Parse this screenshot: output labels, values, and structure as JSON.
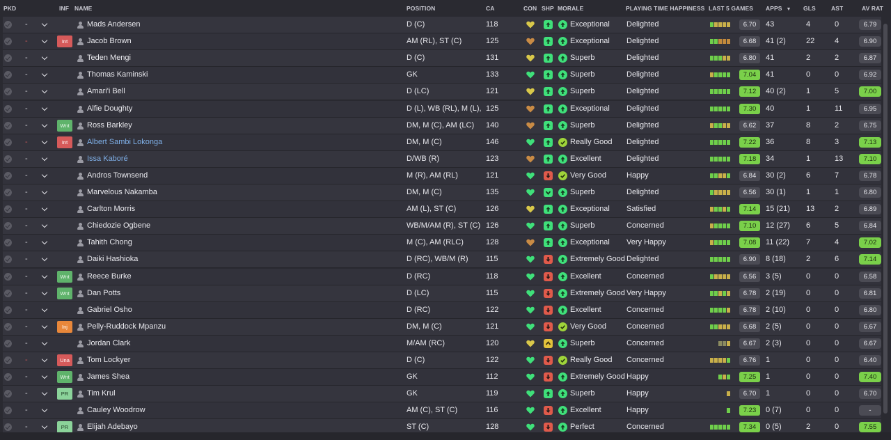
{
  "headers": {
    "pkd": "PKD",
    "inf": "INF",
    "name": "NAME",
    "position": "POSITION",
    "ca": "CA",
    "con": "CON",
    "shp": "SHP",
    "morale": "MORALE",
    "pth": "PLAYING TIME HAPPINESS",
    "last5": "LAST 5 GAMES",
    "apps": "APPS",
    "gls": "GLS",
    "ast": "AST",
    "avrat": "AV RAT"
  },
  "colors": {
    "row_bg": "#35353e",
    "green": "#7ad04a",
    "badge_red": "#d65a5a",
    "badge_green": "#5fb36b",
    "badge_orange": "#e8873a",
    "badge_lightgreen": "#8bd39a",
    "link_blue": "#7fb0e8"
  },
  "players": [
    {
      "dash": "-",
      "red": false,
      "inf": "",
      "name": "Mads Andersen",
      "link": false,
      "position": "D (C)",
      "ca": "118",
      "con": "yellow",
      "shp": "up",
      "mor": "up",
      "morale": "Exceptional",
      "pth": "Delighted",
      "form": "gyyyy",
      "l5": "6.70",
      "l5hi": false,
      "apps": "43",
      "gls": "4",
      "ast": "0",
      "avr": "6.79",
      "avrhi": false
    },
    {
      "dash": "-",
      "red": true,
      "inf": "Int",
      "name": "Jacob Brown",
      "link": false,
      "position": "AM (RL), ST (C)",
      "ca": "125",
      "con": "orange",
      "shp": "up",
      "mor": "up",
      "morale": "Exceptional",
      "pth": "Delighted",
      "form": "ggooo",
      "l5": "6.68",
      "l5hi": false,
      "apps": "41 (2)",
      "gls": "22",
      "ast": "4",
      "avr": "6.90",
      "avrhi": false
    },
    {
      "dash": "-",
      "red": false,
      "inf": "",
      "name": "Teden Mengi",
      "link": false,
      "position": "D (C)",
      "ca": "131",
      "con": "yellow",
      "shp": "up",
      "mor": "up",
      "morale": "Superb",
      "pth": "Delighted",
      "form": "gggyy",
      "l5": "6.80",
      "l5hi": false,
      "apps": "41",
      "gls": "2",
      "ast": "2",
      "avr": "6.87",
      "avrhi": false
    },
    {
      "dash": "-",
      "red": false,
      "inf": "",
      "name": "Thomas Kaminski",
      "link": false,
      "position": "GK",
      "ca": "133",
      "con": "green",
      "shp": "up",
      "mor": "up",
      "morale": "Superb",
      "pth": "Delighted",
      "form": "ygggg",
      "l5": "7.04",
      "l5hi": true,
      "apps": "41",
      "gls": "0",
      "ast": "0",
      "avr": "6.92",
      "avrhi": false
    },
    {
      "dash": "-",
      "red": false,
      "inf": "",
      "name": "Amari'i Bell",
      "link": false,
      "position": "D (LC)",
      "ca": "121",
      "con": "yellow",
      "shp": "up",
      "mor": "up",
      "morale": "Superb",
      "pth": "Delighted",
      "form": "ggggg",
      "l5": "7.12",
      "l5hi": true,
      "apps": "40 (2)",
      "gls": "1",
      "ast": "5",
      "avr": "7.00",
      "avrhi": true
    },
    {
      "dash": "-",
      "red": false,
      "inf": "",
      "name": "Alfie Doughty",
      "link": false,
      "position": "D (L), WB (RL), M (L),...",
      "ca": "125",
      "con": "orange",
      "shp": "up",
      "mor": "up",
      "morale": "Exceptional",
      "pth": "Delighted",
      "form": "ggggg",
      "l5": "7.30",
      "l5hi": true,
      "apps": "40",
      "gls": "1",
      "ast": "11",
      "avr": "6.95",
      "avrhi": false
    },
    {
      "dash": "-",
      "red": false,
      "inf": "Wnt",
      "name": "Ross Barkley",
      "link": false,
      "position": "DM, M (C), AM (LC)",
      "ca": "140",
      "con": "orange",
      "shp": "up",
      "mor": "up",
      "morale": "Superb",
      "pth": "Delighted",
      "form": "yggyy",
      "l5": "6.62",
      "l5hi": false,
      "apps": "37",
      "gls": "8",
      "ast": "2",
      "avr": "6.75",
      "avrhi": false
    },
    {
      "dash": "-",
      "red": true,
      "inf": "Int",
      "name": "Albert Sambi Lokonga",
      "link": true,
      "position": "DM, M (C)",
      "ca": "146",
      "con": "green",
      "shp": "up",
      "mor": "check",
      "morale": "Really Good",
      "pth": "Delighted",
      "form": "ggggg",
      "l5": "7.22",
      "l5hi": true,
      "apps": "36",
      "gls": "8",
      "ast": "3",
      "avr": "7.13",
      "avrhi": true
    },
    {
      "dash": "-",
      "red": false,
      "inf": "",
      "name": "Issa Kaboré",
      "link": true,
      "position": "D/WB (R)",
      "ca": "123",
      "con": "orange",
      "shp": "up",
      "mor": "up",
      "morale": "Excellent",
      "pth": "Delighted",
      "form": "ggggg",
      "l5": "7.18",
      "l5hi": true,
      "apps": "34",
      "gls": "1",
      "ast": "13",
      "avr": "7.10",
      "avrhi": true
    },
    {
      "dash": "-",
      "red": false,
      "inf": "",
      "name": "Andros Townsend",
      "link": false,
      "position": "M (R), AM (RL)",
      "ca": "121",
      "con": "green",
      "shp": "down",
      "mor": "check",
      "morale": "Very Good",
      "pth": "Happy",
      "form": "ggyyg",
      "l5": "6.84",
      "l5hi": false,
      "apps": "30 (2)",
      "gls": "6",
      "ast": "7",
      "avr": "6.78",
      "avrhi": false
    },
    {
      "dash": "-",
      "red": false,
      "inf": "",
      "name": "Marvelous Nakamba",
      "link": false,
      "position": "DM, M (C)",
      "ca": "135",
      "con": "green",
      "shp": "check",
      "mor": "up",
      "morale": "Superb",
      "pth": "Delighted",
      "form": "gyyyy",
      "l5": "6.56",
      "l5hi": false,
      "apps": "30 (1)",
      "gls": "1",
      "ast": "1",
      "avr": "6.80",
      "avrhi": false
    },
    {
      "dash": "-",
      "red": false,
      "inf": "",
      "name": "Carlton Morris",
      "link": false,
      "position": "AM (L), ST (C)",
      "ca": "126",
      "con": "yellow",
      "shp": "up",
      "mor": "up",
      "morale": "Exceptional",
      "pth": "Satisfied",
      "form": "yggyg",
      "l5": "7.14",
      "l5hi": true,
      "apps": "15 (21)",
      "gls": "13",
      "ast": "2",
      "avr": "6.89",
      "avrhi": false
    },
    {
      "dash": "-",
      "red": false,
      "inf": "",
      "name": "Chiedozie Ogbene",
      "link": false,
      "position": "WB/M/AM (R), ST (C)",
      "ca": "126",
      "con": "green",
      "shp": "up",
      "mor": "up",
      "morale": "Superb",
      "pth": "Concerned",
      "form": "ygggg",
      "l5": "7.10",
      "l5hi": true,
      "apps": "12 (27)",
      "gls": "6",
      "ast": "5",
      "avr": "6.84",
      "avrhi": false
    },
    {
      "dash": "-",
      "red": false,
      "inf": "",
      "name": "Tahith Chong",
      "link": false,
      "position": "M (C), AM (RLC)",
      "ca": "128",
      "con": "orange",
      "shp": "up",
      "mor": "up",
      "morale": "Exceptional",
      "pth": "Very Happy",
      "form": "ygggg",
      "l5": "7.08",
      "l5hi": true,
      "apps": "11 (22)",
      "gls": "7",
      "ast": "4",
      "avr": "7.02",
      "avrhi": true
    },
    {
      "dash": "-",
      "red": false,
      "inf": "",
      "name": "Daiki Hashioka",
      "link": false,
      "position": "D (RC), WB/M (R)",
      "ca": "115",
      "con": "green",
      "shp": "down",
      "mor": "up",
      "morale": "Extremely Good",
      "pth": "Delighted",
      "form": "ggggg",
      "l5": "6.90",
      "l5hi": false,
      "apps": "8 (18)",
      "gls": "2",
      "ast": "6",
      "avr": "7.14",
      "avrhi": true
    },
    {
      "dash": "-",
      "red": false,
      "inf": "Wnt",
      "name": "Reece Burke",
      "link": false,
      "position": "D (RC)",
      "ca": "118",
      "con": "green",
      "shp": "down",
      "mor": "up",
      "morale": "Excellent",
      "pth": "Concerned",
      "form": "gyyyy",
      "l5": "6.56",
      "l5hi": false,
      "apps": "3 (5)",
      "gls": "0",
      "ast": "0",
      "avr": "6.58",
      "avrhi": false
    },
    {
      "dash": "-",
      "red": false,
      "inf": "Wnt",
      "name": "Dan Potts",
      "link": false,
      "position": "D (LC)",
      "ca": "115",
      "con": "green",
      "shp": "down",
      "mor": "up",
      "morale": "Extremely Good",
      "pth": "Very Happy",
      "form": "ggygy",
      "l5": "6.78",
      "l5hi": false,
      "apps": "2 (19)",
      "gls": "0",
      "ast": "0",
      "avr": "6.81",
      "avrhi": false
    },
    {
      "dash": "-",
      "red": false,
      "inf": "",
      "name": "Gabriel Osho",
      "link": false,
      "position": "D (RC)",
      "ca": "122",
      "con": "green",
      "shp": "down",
      "mor": "up",
      "morale": "Excellent",
      "pth": "Concerned",
      "form": "ggggy",
      "l5": "6.78",
      "l5hi": false,
      "apps": "2 (10)",
      "gls": "0",
      "ast": "0",
      "avr": "6.80",
      "avrhi": false
    },
    {
      "dash": "-",
      "red": false,
      "inf": "Inj",
      "name": "Pelly-Ruddock Mpanzu",
      "link": false,
      "position": "DM, M (C)",
      "ca": "121",
      "con": "green",
      "shp": "down",
      "mor": "check",
      "morale": "Very Good",
      "pth": "Concerned",
      "form": "ggyyy",
      "l5": "6.68",
      "l5hi": false,
      "apps": "2 (5)",
      "gls": "0",
      "ast": "0",
      "avr": "6.67",
      "avrhi": false
    },
    {
      "dash": "-",
      "red": false,
      "inf": "",
      "name": "Jordan Clark",
      "link": false,
      "position": "M/AM (RC)",
      "ca": "120",
      "con": "yellow",
      "shp": "caret",
      "mor": "up",
      "morale": "Superb",
      "pth": "Concerned",
      "form": "ddy",
      "l5": "6.67",
      "l5hi": false,
      "apps": "2 (3)",
      "gls": "0",
      "ast": "0",
      "avr": "6.67",
      "avrhi": false
    },
    {
      "dash": "-",
      "red": true,
      "inf": "Una",
      "name": "Tom Lockyer",
      "link": false,
      "position": "D (C)",
      "ca": "122",
      "con": "green",
      "shp": "down",
      "mor": "check",
      "morale": "Really Good",
      "pth": "Concerned",
      "form": "yyyyg",
      "l5": "6.76",
      "l5hi": false,
      "apps": "1",
      "gls": "0",
      "ast": "0",
      "avr": "6.40",
      "avrhi": false
    },
    {
      "dash": "-",
      "red": false,
      "inf": "Wnt",
      "name": "James Shea",
      "link": false,
      "position": "GK",
      "ca": "112",
      "con": "green",
      "shp": "down",
      "mor": "up",
      "morale": "Extremely Good",
      "pth": "Happy",
      "form": "gyg",
      "l5": "7.25",
      "l5hi": true,
      "apps": "1",
      "gls": "0",
      "ast": "0",
      "avr": "7.40",
      "avrhi": true
    },
    {
      "dash": "-",
      "red": false,
      "inf": "PR",
      "name": "Tim Krul",
      "link": false,
      "position": "GK",
      "ca": "119",
      "con": "green",
      "shp": "up",
      "mor": "up",
      "morale": "Superb",
      "pth": "Happy",
      "form": "y",
      "l5": "6.70",
      "l5hi": false,
      "apps": "1",
      "gls": "0",
      "ast": "0",
      "avr": "6.70",
      "avrhi": false
    },
    {
      "dash": "-",
      "red": false,
      "inf": "",
      "name": "Cauley Woodrow",
      "link": false,
      "position": "AM (C), ST (C)",
      "ca": "116",
      "con": "green",
      "shp": "down",
      "mor": "up",
      "morale": "Excellent",
      "pth": "Happy",
      "form": "g",
      "l5": "7.23",
      "l5hi": true,
      "apps": "0 (7)",
      "gls": "0",
      "ast": "0",
      "avr": "-",
      "avrhi": false
    },
    {
      "dash": "-",
      "red": false,
      "inf": "PR",
      "name": "Elijah Adebayo",
      "link": false,
      "position": "ST (C)",
      "ca": "128",
      "con": "green",
      "shp": "down",
      "mor": "up",
      "morale": "Perfect",
      "pth": "Concerned",
      "form": "ggggg",
      "l5": "7.34",
      "l5hi": true,
      "apps": "0 (5)",
      "gls": "2",
      "ast": "0",
      "avr": "7.55",
      "avrhi": true
    }
  ]
}
